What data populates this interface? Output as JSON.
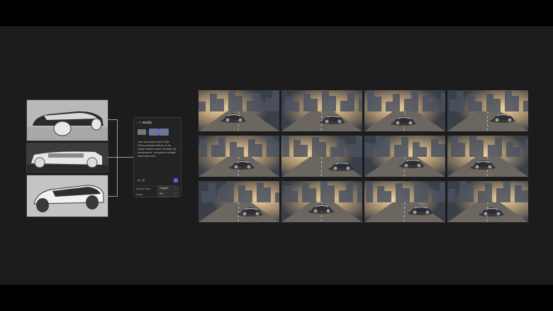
{
  "panel": {
    "title": "Modify",
    "prompt": "Turn view action shot of this Frenzy concept vehicle on an empty modern street, futuristic city environment. Low golden sunlight and motion blur.",
    "aspect_ratio_label": "Aspect Ratio",
    "aspect_ratio_value": "Original",
    "mode_label": "Mode",
    "mode_value": "Pro"
  },
  "reference_images": [
    "car-front-quarter-sketch",
    "car-side-sketch",
    "car-rear-quarter-sketch"
  ],
  "results": [
    {
      "variant": "a"
    },
    {
      "variant": "b"
    },
    {
      "variant": "c"
    },
    {
      "variant": "d"
    },
    {
      "variant": "e"
    },
    {
      "variant": "f"
    },
    {
      "variant": "g"
    },
    {
      "variant": "h"
    },
    {
      "variant": "i"
    },
    {
      "variant": "j"
    },
    {
      "variant": "k"
    },
    {
      "variant": "l"
    }
  ],
  "colors": {
    "accent": "#5a5cf0",
    "background": "#1c1c1c",
    "sun": "#f4d49a"
  }
}
